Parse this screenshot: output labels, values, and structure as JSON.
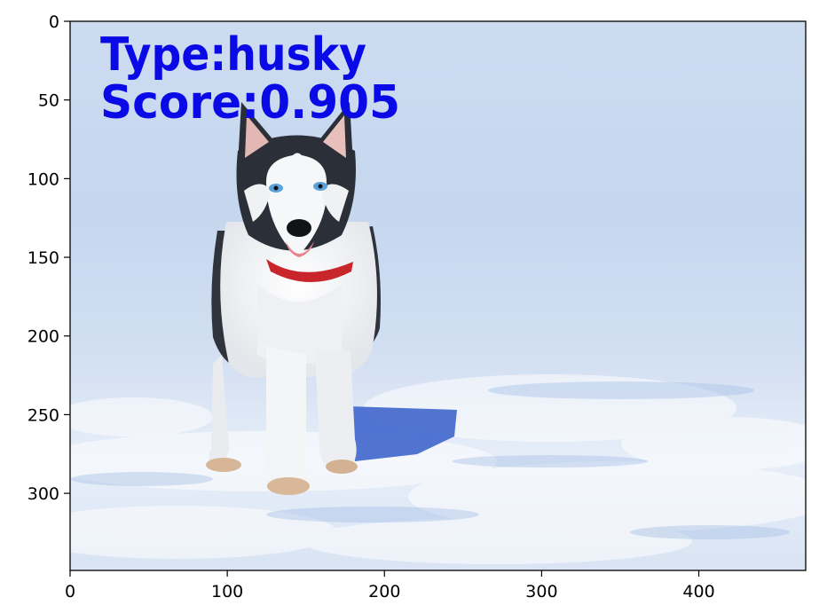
{
  "colors": {
    "overlay_text": "#0a0ae6",
    "sky": "#c9d8ee",
    "snow": "#e8eff9",
    "shadow": "#3a62c9",
    "fur_dark": "#2b2f38",
    "fur_light": "#f3f4f6",
    "collar": "#c8262b"
  },
  "overlay": {
    "type_text": "Type:husky",
    "score_text": "Score:0.905"
  },
  "axes": {
    "x_ticks": [
      0,
      100,
      200,
      300,
      400
    ],
    "y_ticks": [
      0,
      50,
      100,
      150,
      200,
      250,
      300
    ],
    "x_range": [
      0,
      468
    ],
    "y_range": [
      0,
      349
    ],
    "y_inverted": true
  },
  "image": {
    "subject_icon": "husky-puppy-photo"
  }
}
